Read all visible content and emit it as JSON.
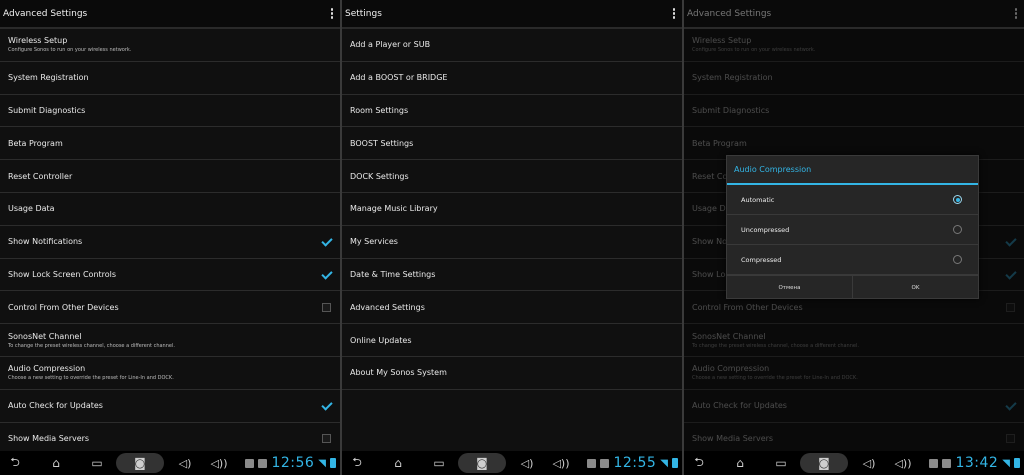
{
  "panel1": {
    "title": "Advanced Settings",
    "items": [
      {
        "label": "Wireless Setup",
        "sub": "Configure Sonos to run on your wireless network.",
        "check": null
      },
      {
        "label": "System Registration",
        "sub": "",
        "check": null
      },
      {
        "label": "Submit Diagnostics",
        "sub": "",
        "check": null
      },
      {
        "label": "Beta Program",
        "sub": "",
        "check": null
      },
      {
        "label": "Reset Controller",
        "sub": "",
        "check": null
      },
      {
        "label": "Usage Data",
        "sub": "",
        "check": null
      },
      {
        "label": "Show Notifications",
        "sub": "",
        "check": true
      },
      {
        "label": "Show Lock Screen Controls",
        "sub": "",
        "check": true
      },
      {
        "label": "Control From Other Devices",
        "sub": "",
        "check": false
      },
      {
        "label": "SonosNet Channel",
        "sub": "To change the preset wireless channel, choose a different channel.",
        "check": null
      },
      {
        "label": "Audio Compression",
        "sub": "Choose a new setting to override the preset for Line-In and DOCK.",
        "check": null
      },
      {
        "label": "Auto Check for Updates",
        "sub": "",
        "check": true
      },
      {
        "label": "Show Media Servers",
        "sub": "",
        "check": false
      }
    ],
    "clock": "12:56"
  },
  "panel2": {
    "title": "Settings",
    "items": [
      {
        "label": "Add a Player or SUB"
      },
      {
        "label": "Add a BOOST or BRIDGE"
      },
      {
        "label": "Room Settings"
      },
      {
        "label": "BOOST Settings"
      },
      {
        "label": "DOCK Settings"
      },
      {
        "label": "Manage Music Library"
      },
      {
        "label": "My Services"
      },
      {
        "label": "Date & Time Settings"
      },
      {
        "label": "Advanced Settings"
      },
      {
        "label": "Online Updates"
      },
      {
        "label": "About My Sonos System"
      }
    ],
    "clock": "12:55"
  },
  "panel3": {
    "title": "Advanced Settings",
    "clock": "13:42",
    "dialog": {
      "title": "Audio Compression",
      "options": [
        {
          "label": "Automatic",
          "selected": true
        },
        {
          "label": "Uncompressed",
          "selected": false
        },
        {
          "label": "Compressed",
          "selected": false
        }
      ],
      "cancel": "Отмена",
      "ok": "OK"
    }
  },
  "navbar": {
    "icons": [
      "back-icon",
      "home-icon",
      "recent-apps-icon",
      "screenshot-icon",
      "volume-down-icon",
      "volume-up-icon"
    ]
  },
  "colors": {
    "accent": "#33b5e5",
    "background": "#101010"
  }
}
